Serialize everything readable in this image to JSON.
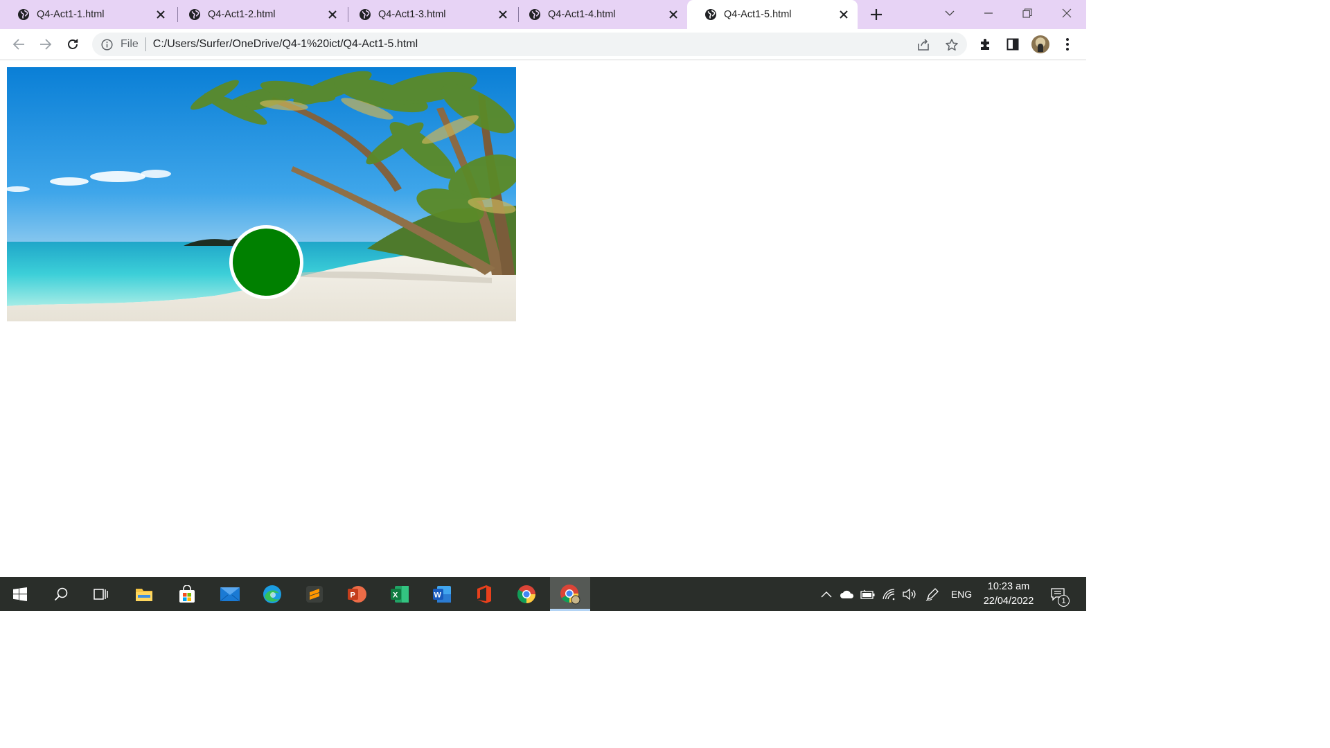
{
  "browser": {
    "tabs": [
      {
        "title": "Q4-Act1-1.html",
        "active": false
      },
      {
        "title": "Q4-Act1-2.html",
        "active": false
      },
      {
        "title": "Q4-Act1-3.html",
        "active": false
      },
      {
        "title": "Q4-Act1-4.html",
        "active": false
      },
      {
        "title": "Q4-Act1-5.html",
        "active": true
      }
    ],
    "address_bar": {
      "scheme_label": "File",
      "url": "C:/Users/Surfer/OneDrive/Q4-1%20ict/Q4-Act1-5.html"
    },
    "accent_color": "#e7d3f5"
  },
  "page": {
    "image": {
      "subject": "tropical beach with palm trees"
    },
    "circle": {
      "color": "#008000",
      "border_color": "#ffffff"
    }
  },
  "taskbar": {
    "apps": [
      "windows-start",
      "search",
      "task-view",
      "file-explorer",
      "microsoft-store",
      "mail",
      "edge",
      "sublime-text",
      "powerpoint",
      "excel",
      "word",
      "office",
      "chrome",
      "chrome-profile"
    ],
    "tray": {
      "language": "ENG",
      "time": "10:23 am",
      "date": "22/04/2022",
      "notification_count": "1"
    }
  }
}
